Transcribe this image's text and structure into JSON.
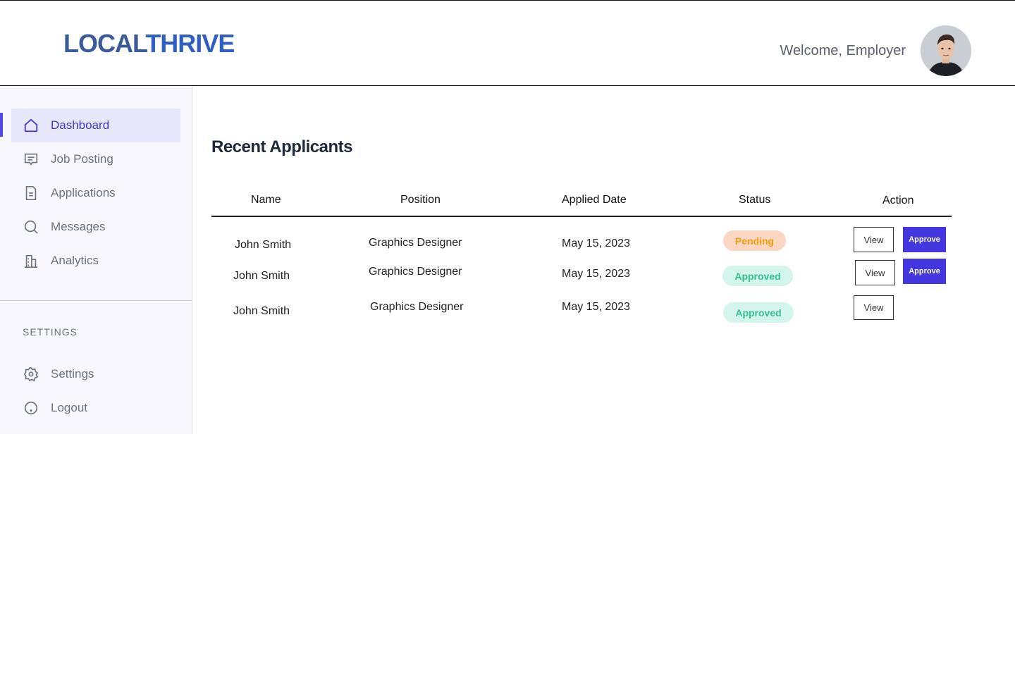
{
  "brand": {
    "part1": "LOCAL",
    "part2": "THRIVE"
  },
  "header": {
    "welcome": "Welcome, Employer",
    "avatar": "user-avatar"
  },
  "sidebar": {
    "items": [
      {
        "label": "Dashboard",
        "icon": "home-icon",
        "active": true
      },
      {
        "label": "Job Posting",
        "icon": "message-icon"
      },
      {
        "label": "Applications",
        "icon": "document-icon"
      },
      {
        "label": "Messages",
        "icon": "search-icon"
      },
      {
        "label": "Analytics",
        "icon": "building-icon"
      }
    ],
    "settings_title": "SETTINGS",
    "settings_items": [
      {
        "label": "Settings",
        "icon": "gear-icon"
      },
      {
        "label": "Logout",
        "icon": "logout-icon"
      }
    ]
  },
  "main": {
    "title": "Recent Applicants",
    "columns": [
      "Name",
      "Position",
      "Applied Date",
      "Status",
      "Action"
    ],
    "rows": [
      {
        "name": "John Smith",
        "position": "Graphics Designer",
        "date": "May 15, 2023",
        "status": "Pending",
        "view": "View",
        "approve": "Approve"
      },
      {
        "name": "John Smith",
        "position": "Graphics Designer",
        "date": "May 15, 2023",
        "status": "Approved",
        "view": "View",
        "approve": "Approve"
      },
      {
        "name": "John Smith",
        "position": "Graphics Designer",
        "date": "May 15, 2023",
        "status": "Approved",
        "view": "View"
      }
    ]
  },
  "colors": {
    "accent": "#4f46e5",
    "brand": "#2f5ec4",
    "pending": "#f59e0b",
    "approved": "#34c08f"
  }
}
